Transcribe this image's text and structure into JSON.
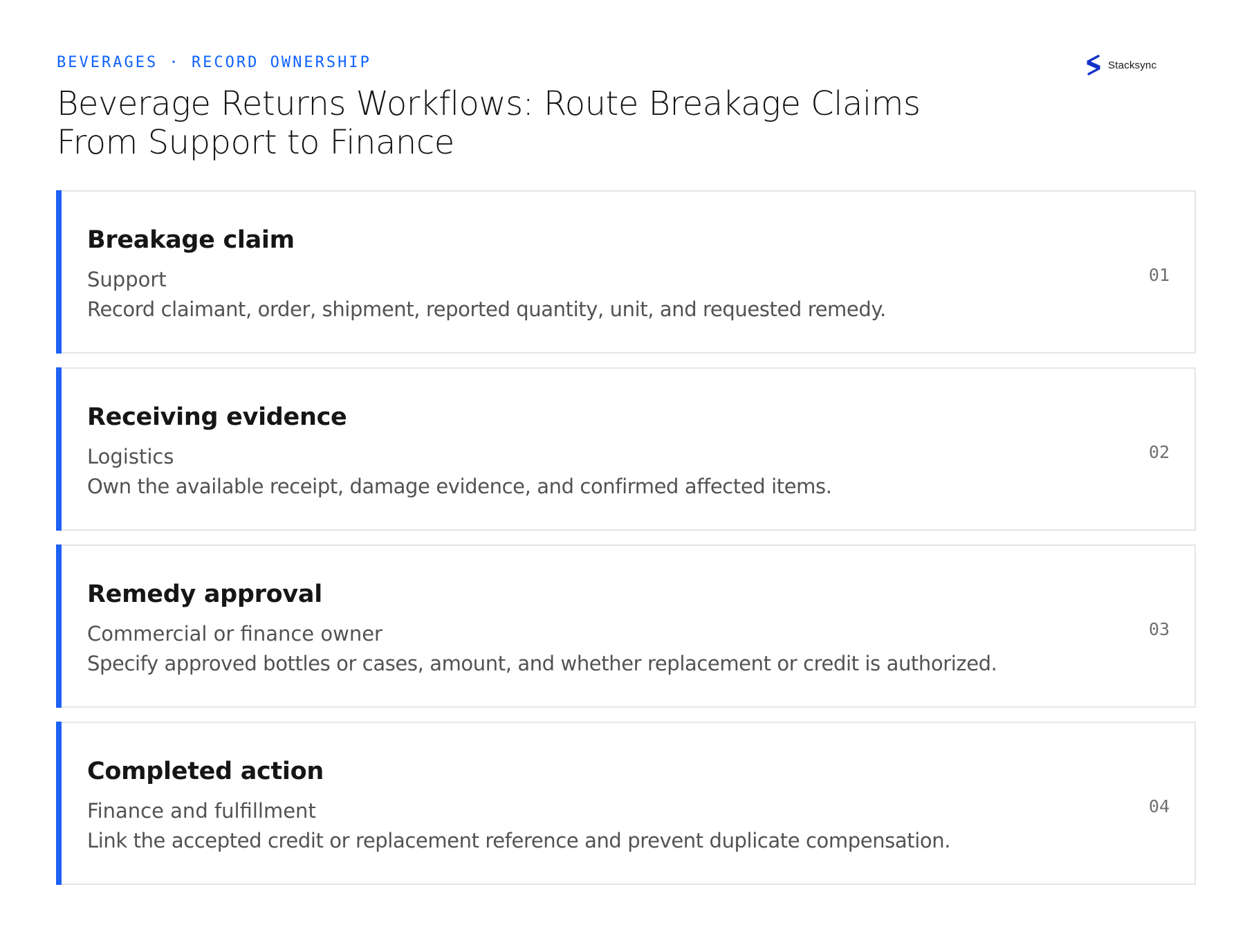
{
  "header": {
    "eyebrow": "BEVERAGES · RECORD OWNERSHIP",
    "title": "Beverage Returns Workflows: Route Breakage Claims From Support to Finance"
  },
  "logo": {
    "text": "Stacksync",
    "icon": "stacksync-logo-icon",
    "color": "#1432c8"
  },
  "colors": {
    "accent": "#1e62f5",
    "eyebrow": "#0f62fe"
  },
  "steps": [
    {
      "title": "Breakage claim",
      "owner": "Support",
      "description": "Record claimant, order, shipment, reported quantity, unit, and requested remedy.",
      "number": "01"
    },
    {
      "title": "Receiving evidence",
      "owner": "Logistics",
      "description": "Own the available receipt, damage evidence, and confirmed affected items.",
      "number": "02"
    },
    {
      "title": "Remedy approval",
      "owner": "Commercial or finance owner",
      "description": "Specify approved bottles or cases, amount, and whether replacement or credit is authorized.",
      "number": "03"
    },
    {
      "title": "Completed action",
      "owner": "Finance and fulfillment",
      "description": "Link the accepted credit or replacement reference and prevent duplicate compensation.",
      "number": "04"
    }
  ]
}
